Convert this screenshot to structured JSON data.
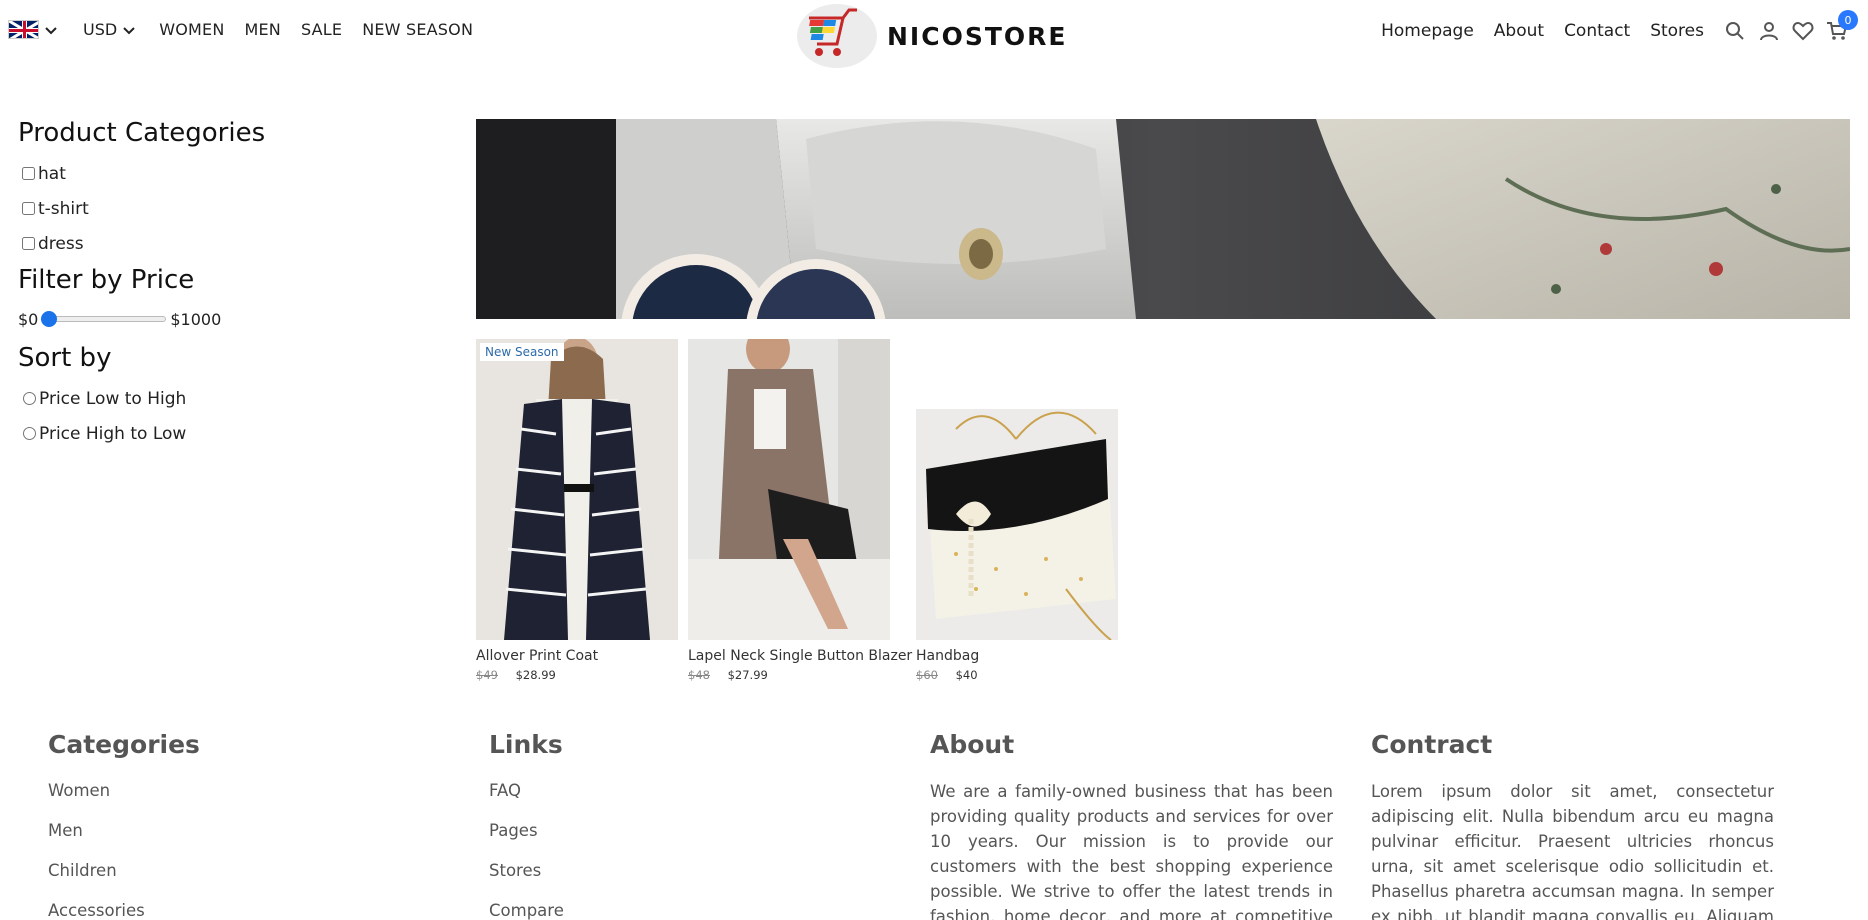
{
  "nav": {
    "language_icon": "uk-flag-icon",
    "currency": "USD",
    "menu": [
      "WOMEN",
      "MEN",
      "SALE",
      "NEW SEASON"
    ],
    "brand": "NICOSTORE",
    "right_links": [
      "Homepage",
      "About",
      "Contact",
      "Stores"
    ],
    "cart_count": "0",
    "accent_color": "#2879fe"
  },
  "sidebar": {
    "categories_title": "Product Categories",
    "categories": [
      "hat",
      "t-shirt",
      "dress"
    ],
    "price_title": "Filter by Price",
    "price_min": "$0",
    "price_max": "$1000",
    "price_slider_value": 0,
    "sort_title": "Sort by",
    "sort_options": [
      "Price Low to High",
      "Price High to Low"
    ]
  },
  "products": [
    {
      "name": "Allover Print Coat",
      "old_price": "$49",
      "price": "$28.99",
      "tag": "New Season"
    },
    {
      "name": "Lapel Neck Single Button Blazer",
      "old_price": "$48",
      "price": "$27.99",
      "tag": ""
    },
    {
      "name": "Handbag",
      "old_price": "$60",
      "price": "$40",
      "tag": ""
    }
  ],
  "footer": {
    "categories": {
      "title": "Categories",
      "items": [
        "Women",
        "Men",
        "Children",
        "Accessories"
      ]
    },
    "links": {
      "title": "Links",
      "items": [
        "FAQ",
        "Pages",
        "Stores",
        "Compare"
      ]
    },
    "about": {
      "title": "About",
      "text": "We are a family-owned business that has been providing quality products and services for over 10 years. Our mission is to provide our customers with the best shopping experience possible. We strive to offer the latest trends in fashion, home decor, and more at competitive prices. Our team"
    },
    "contract": {
      "title": "Contract",
      "text": "Lorem ipsum dolor sit amet, consectetur adipiscing elit. Nulla bibendum arcu eu magna pulvinar efficitur. Praesent ultricies rhoncus urna, sit amet scelerisque odio sollicitudin et. Phasellus pharetra accumsan magna. In semper ex nibh, ut blandit magna convallis eu. Aliquam eget neque"
    }
  }
}
